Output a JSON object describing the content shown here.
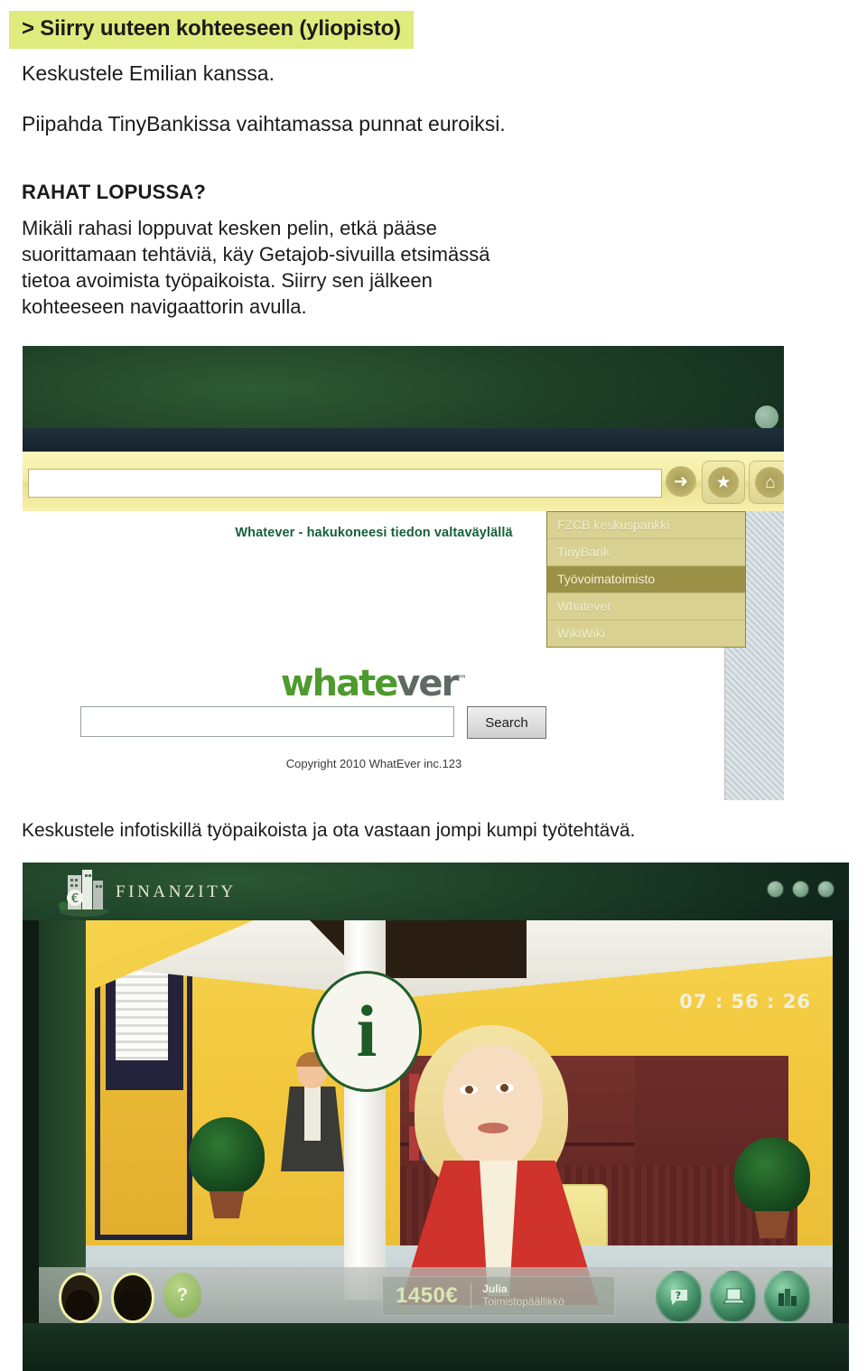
{
  "document": {
    "highlight_heading": "> Siirry uuteen kohteeseen (yliopisto)",
    "line_1": "Keskustele Emilian kanssa.",
    "line_2": "Piipahda TinyBankissa vaihtamassa punnat euroiksi.",
    "section_heading": "RAHAT LOPUSSA?",
    "section_body": "Mikäli rahasi loppuvat kesken pelin, etkä pääse suorittamaan tehtäviä, käy Getajob-sivuilla etsimässä tietoa avoimista työpaikoista. Siirry sen jälkeen kohteeseen navigaattorin avulla.",
    "mid_caption": "Keskustele infotiskillä työpaikoista ja ota vastaan jompi kumpi työtehtävä.",
    "highlight_color": "#dfeb7d"
  },
  "browser_shot": {
    "toolbar": {
      "url_value": "",
      "go_icon": "arrow-right-icon",
      "favorites_icon": "star-icon",
      "home_icon": "home-icon"
    },
    "navigator_dropdown": {
      "items": [
        {
          "label": "FZCB keskuspankki",
          "selected": false
        },
        {
          "label": "TinyBank",
          "selected": false
        },
        {
          "label": "Työvoimatoimisto",
          "selected": true
        },
        {
          "label": "Whatever",
          "selected": false
        },
        {
          "label": "WikiWiki",
          "selected": false
        }
      ]
    },
    "page": {
      "tagline": "Whatever - hakukoneesi tiedon valtaväylällä",
      "logo_part_1": "whate",
      "logo_part_2": "ver",
      "logo_tm": "™",
      "search_value": "",
      "search_button": "Search",
      "copyright": "Copyright 2010 WhatEver inc.123"
    }
  },
  "game_shot": {
    "brand": "FINANZITY",
    "brand_icon": "city-buildings-euro-icon",
    "window_buttons": [
      "minimize-button",
      "maximize-button",
      "close-button"
    ],
    "timer": "07 : 56 : 26",
    "info_sign": "i",
    "hud": {
      "money": "1450€",
      "character_name": "Julia",
      "character_role": "Toimistopäällikkö",
      "left_icons": [
        "portrait-avatar-1",
        "portrait-avatar-2",
        "help-question-icon"
      ],
      "right_icons": [
        {
          "name": "chat-bubble-icon",
          "glyph": "?"
        },
        {
          "name": "laptop-icon",
          "glyph": "▭"
        },
        {
          "name": "city-icon",
          "glyph": "▮"
        }
      ]
    }
  }
}
